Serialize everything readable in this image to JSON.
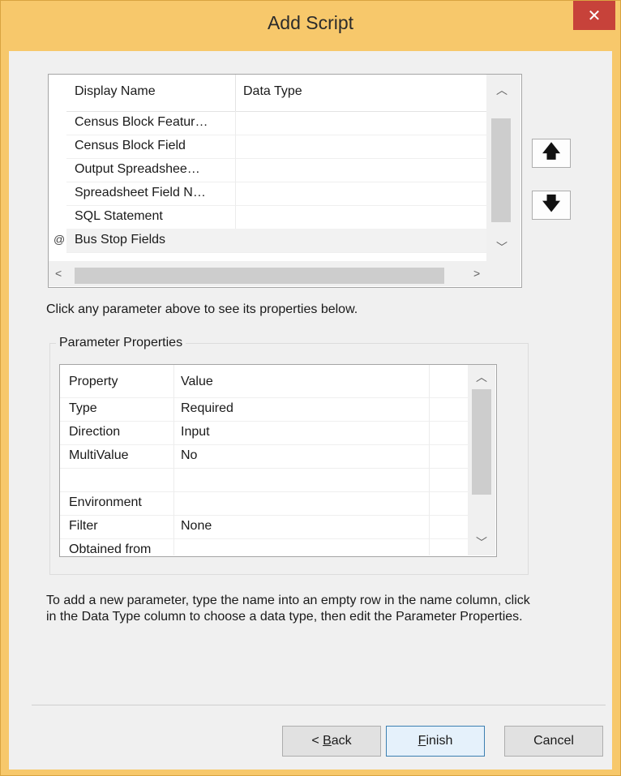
{
  "window": {
    "title": "Add Script",
    "close_glyph": "✕"
  },
  "parameters_grid": {
    "headers": [
      "Display Name",
      "Data Type"
    ],
    "rows": [
      {
        "name": "Census Block Featur…",
        "type": ""
      },
      {
        "name": "Census Block Field",
        "type": ""
      },
      {
        "name": "Output Spreadshee…",
        "type": ""
      },
      {
        "name": "Spreadsheet Field N…",
        "type": ""
      },
      {
        "name": "SQL Statement",
        "type": ""
      },
      {
        "name": "Bus Stop Fields",
        "type": ""
      }
    ],
    "selected_row_marker": "@"
  },
  "move_buttons": {
    "up_glyph": "🡅",
    "down_glyph": "🡇"
  },
  "hint": "Click any parameter above to see its properties below.",
  "parameter_properties": {
    "label": "Parameter Properties",
    "headers": [
      "Property",
      "Value"
    ],
    "rows": [
      {
        "property": "Type",
        "value": "Required"
      },
      {
        "property": "Direction",
        "value": "Input"
      },
      {
        "property": "MultiValue",
        "value": "No"
      },
      {
        "property": "",
        "value": ""
      },
      {
        "property": "Environment",
        "value": ""
      },
      {
        "property": "Filter",
        "value": "None"
      },
      {
        "property": "Obtained from",
        "value": ""
      }
    ]
  },
  "info_text": "To add a new parameter, type the name into an empty row in the name column, click in the Data Type column to choose a data type, then edit the Parameter Properties.",
  "buttons": {
    "back": {
      "prefix": "< ",
      "mnemonic": "B",
      "rest": "ack"
    },
    "finish": {
      "mnemonic": "F",
      "rest": "inish"
    },
    "cancel": {
      "label": "Cancel"
    }
  },
  "colors": {
    "title_bar": "#f7c86b",
    "close_button": "#c7423a",
    "dialog_background": "#f0f0f0"
  }
}
